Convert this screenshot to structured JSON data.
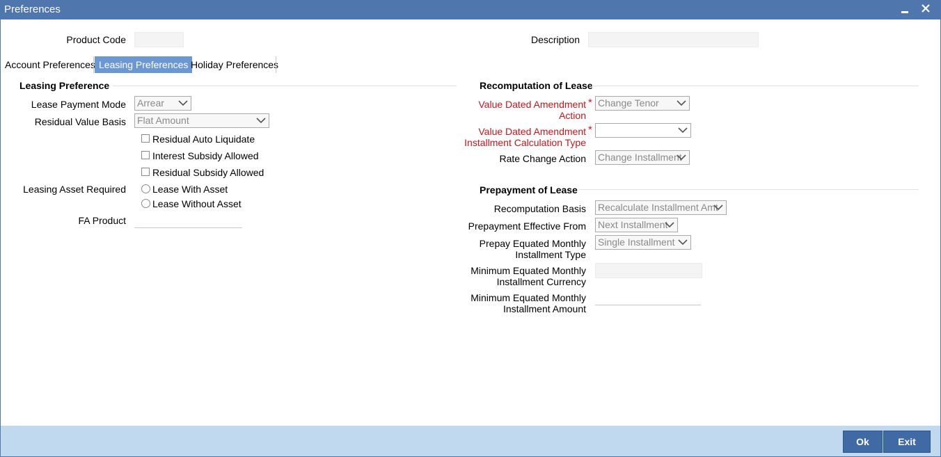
{
  "window": {
    "title": "Preferences",
    "minimize_label": "▄",
    "close_label": "✕"
  },
  "header": {
    "product_code_label": "Product Code",
    "product_code_value": "",
    "description_label": "Description",
    "description_value": ""
  },
  "tabs": [
    {
      "label": "Account Preferences",
      "active": false
    },
    {
      "label": "Leasing Preferences",
      "active": true
    },
    {
      "label": "Holiday Preferences",
      "active": false
    }
  ],
  "leasing": {
    "section_title": "Leasing Preference",
    "lease_payment_mode": {
      "label": "Lease Payment Mode",
      "value": "Arrear"
    },
    "residual_value_basis": {
      "label": "Residual Value Basis",
      "value": "Flat Amount"
    },
    "checkboxes": [
      {
        "label": "Residual Auto Liquidate",
        "checked": false
      },
      {
        "label": "Interest Subsidy Allowed",
        "checked": false
      },
      {
        "label": "Residual Subsidy Allowed",
        "checked": false
      }
    ],
    "asset_required_label": "Leasing Asset Required",
    "asset_options": [
      {
        "label": "Lease With Asset",
        "selected": false
      },
      {
        "label": "Lease Without Asset",
        "selected": false
      }
    ],
    "fa_product": {
      "label": "FA Product",
      "value": ""
    }
  },
  "recomputation": {
    "section_title": "Recomputation of Lease",
    "vda_action": {
      "label_line1": "Value Dated Amendment",
      "label_line2": "Action",
      "required_mark": "*",
      "value": "Change Tenor"
    },
    "vda_installment": {
      "label_line1": "Value Dated Amendment",
      "label_line2": "Installment Calculation Type",
      "required_mark": "*",
      "value": ""
    },
    "rate_change": {
      "label": "Rate Change Action",
      "value": "Change Installment"
    }
  },
  "prepayment": {
    "section_title": "Prepayment of Lease",
    "recomputation_basis": {
      "label": "Recomputation Basis",
      "value": "Recalculate Installment Amt"
    },
    "effective_from": {
      "label": "Prepayment Effective From",
      "value": "Next Installment"
    },
    "emi_type": {
      "label_line1": "Prepay Equated Monthly",
      "label_line2": "Installment Type",
      "value": "Single Installment"
    },
    "min_emi_currency": {
      "label_line1": "Minimum Equated Monthly",
      "label_line2": "Installment Currency",
      "value": ""
    },
    "min_emi_amount": {
      "label_line1": "Minimum Equated Monthly",
      "label_line2": "Installment Amount",
      "value": ""
    }
  },
  "footer": {
    "ok_label": "Ok",
    "exit_label": "Exit"
  },
  "colors": {
    "titlebar": "#4f76ad",
    "active_tab": "#6b97d2",
    "footer": "#c1d9ef",
    "button": "#3f6aa3",
    "required": "#c4161c"
  }
}
